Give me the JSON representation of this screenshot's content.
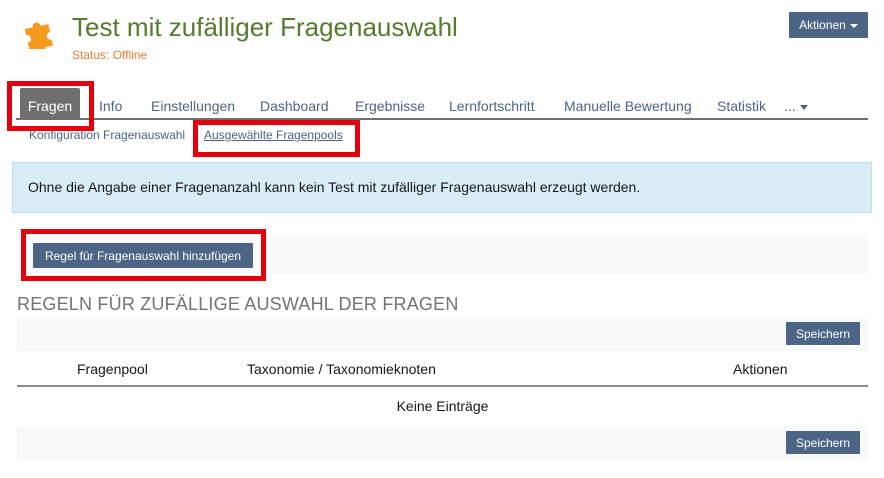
{
  "header": {
    "title": "Test mit zufälliger Fragenauswahl",
    "status": "Status: Offline",
    "actions_label": "Aktionen",
    "icon": "puzzle-icon"
  },
  "tabs": [
    {
      "label": "Fragen",
      "active": true
    },
    {
      "label": "Info"
    },
    {
      "label": "Einstellungen"
    },
    {
      "label": "Dashboard"
    },
    {
      "label": "Ergebnisse"
    },
    {
      "label": "Lernfortschritt"
    },
    {
      "label": "Manuelle Bewertung"
    },
    {
      "label": "Statistik"
    },
    {
      "label": "..."
    }
  ],
  "subtabs": [
    {
      "label": "Konfiguration Fragenauswahl"
    },
    {
      "label": "Ausgewählte Fragenpools",
      "active": true
    }
  ],
  "info_message": "Ohne die Angabe einer Fragenanzahl kann kein Test mit zufälliger Fragenauswahl erzeugt werden.",
  "toolbar": {
    "add_rule_label": "Regel für Fragenauswahl hinzufügen"
  },
  "section_title": "REGELN FÜR ZUFÄLLIGE AUSWAHL DER FRAGEN",
  "table": {
    "save_label": "Speichern",
    "columns": [
      "Fragenpool",
      "Taxonomie / Taxonomieknoten",
      "Aktionen"
    ],
    "empty_text": "Keine Einträge"
  },
  "colors": {
    "title": "#557b2e",
    "status": "#f47c33",
    "button": "#4c6586",
    "active_tab": "#6f6f6f",
    "info_bg": "#d9edf7",
    "highlight": "#e5000d"
  }
}
